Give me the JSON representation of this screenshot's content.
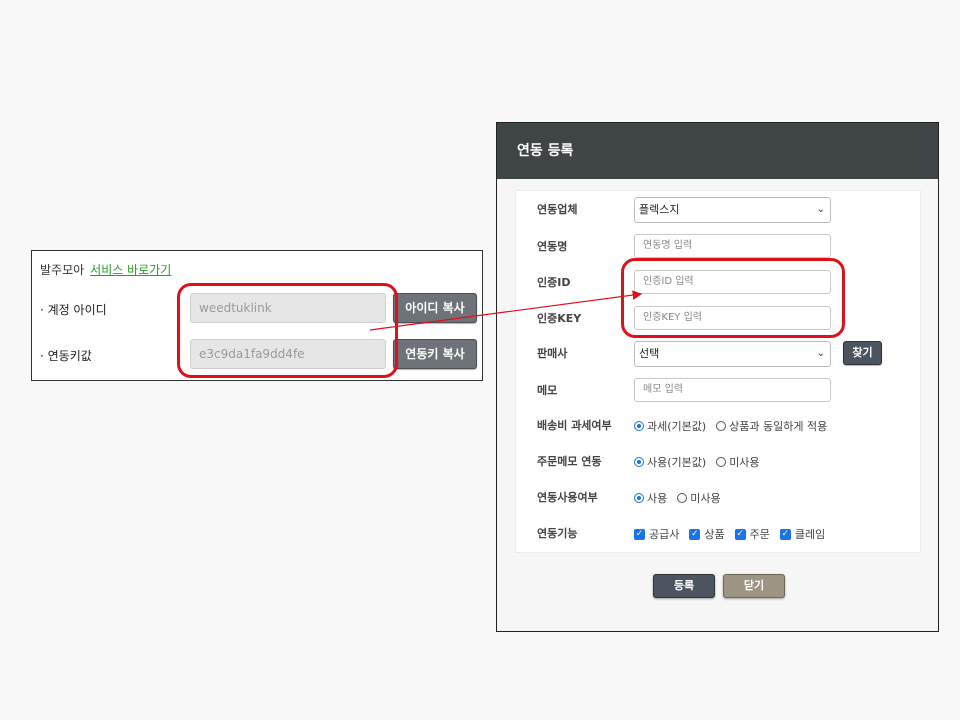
{
  "left_panel": {
    "title": "발주모아",
    "link": "서비스 바로가기",
    "account_label": "· 계정 아이디",
    "account_value": "weedtuklink",
    "copy_id_button": "아이디 복사",
    "key_label": "· 연동키값",
    "key_value": "e3c9da1fa9dd4fe",
    "copy_key_button": "연동키 복사"
  },
  "dialog": {
    "title": "연동 등록",
    "vendor": {
      "label": "연동업체",
      "selected": "플렉스지"
    },
    "name": {
      "label": "연동명",
      "placeholder": "연동명 입력"
    },
    "auth_id": {
      "label": "인증ID",
      "placeholder": "인증ID 입력"
    },
    "auth_key": {
      "label": "인증KEY",
      "placeholder": "인증KEY 입력"
    },
    "seller": {
      "label": "판매사",
      "selected": "선택",
      "find_button": "찾기"
    },
    "memo": {
      "label": "메모",
      "placeholder": "메모 입력"
    },
    "shipping_tax": {
      "label": "배송비 과세여부",
      "option1": "과세(기본값)",
      "option2": "상품과 동일하게 적용",
      "selected": 1
    },
    "order_memo": {
      "label": "주문메모 연동",
      "option1": "사용(기본값)",
      "option2": "미사용",
      "selected": 1
    },
    "usage": {
      "label": "연동사용여부",
      "option1": "사용",
      "option2": "미사용",
      "selected": 1
    },
    "features": {
      "label": "연동기능",
      "items": [
        "공급사",
        "상품",
        "주문",
        "클레임"
      ]
    },
    "register_button": "등록",
    "close_button": "닫기"
  },
  "colors": {
    "highlight": "#e0101a",
    "header_bg": "#3f4447",
    "accent": "#1a73e8",
    "link": "#2a9d2a"
  }
}
